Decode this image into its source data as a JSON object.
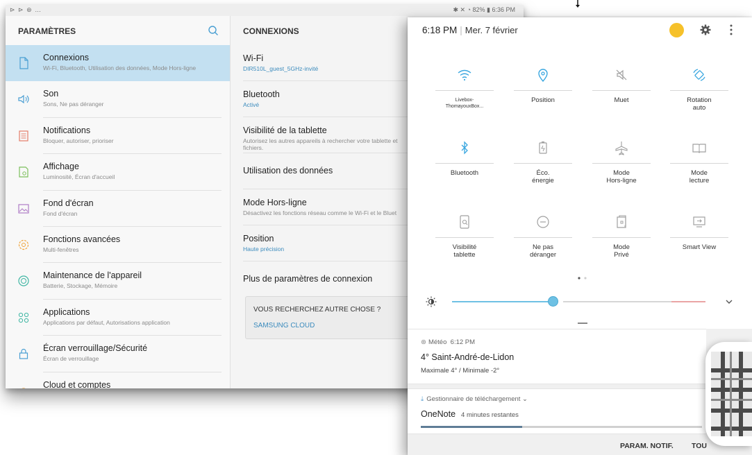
{
  "status_bar": {
    "left_icons": "⊳ ⊳ ⊛ …",
    "right_text": "✱ ✕ ◔ 82% ▮ 6:36 PM"
  },
  "settings": {
    "title": "PARAMÈTRES",
    "items": [
      {
        "label": "Connexions",
        "sub": "Wi-Fi, Bluetooth, Utilisation des données, Mode Hors-ligne",
        "icon": "file-icon",
        "active": true
      },
      {
        "label": "Son",
        "sub": "Sons, Ne pas déranger",
        "icon": "speaker-icon"
      },
      {
        "label": "Notifications",
        "sub": "Bloquer, autoriser, prioriser",
        "icon": "notification-list-icon"
      },
      {
        "label": "Affichage",
        "sub": "Luminosité, Écran d'accueil",
        "icon": "display-icon"
      },
      {
        "label": "Fond d'écran",
        "sub": "Fond d'écran",
        "icon": "image-icon"
      },
      {
        "label": "Fonctions avancées",
        "sub": "Multi-fenêtres",
        "icon": "advanced-gear-icon"
      },
      {
        "label": "Maintenance de l'appareil",
        "sub": "Batterie, Stockage, Mémoire",
        "icon": "maintenance-icon"
      },
      {
        "label": "Applications",
        "sub": "Applications par défaut, Autorisations application",
        "icon": "apps-grid-icon"
      },
      {
        "label": "Écran verrouillage/Sécurité",
        "sub": "Écran de verrouillage",
        "icon": "lock-icon"
      },
      {
        "label": "Cloud et comptes",
        "sub": "",
        "icon": "cloud-key-icon"
      }
    ]
  },
  "connexions": {
    "title": "CONNEXIONS",
    "items": [
      {
        "label": "Wi-Fi",
        "sub": "DIR510L_guest_5GHz-invité",
        "sub_blue": true
      },
      {
        "label": "Bluetooth",
        "sub": "Activé",
        "sub_blue": true
      },
      {
        "label": "Visibilité de la tablette",
        "sub": "Autorisez les autres appareils à rechercher votre tablette et fichiers.",
        "sub_blue": false
      },
      {
        "label": "Utilisation des données",
        "sub": ""
      },
      {
        "label": "Mode Hors-ligne",
        "sub": "Désactivez les fonctions réseau comme le Wi-Fi et le Bluet",
        "sub_blue": false
      },
      {
        "label": "Position",
        "sub": "Haute précision",
        "sub_blue": true
      },
      {
        "label": "Plus de paramètres de connexion",
        "sub": ""
      }
    ],
    "search_card": {
      "question": "VOUS RECHERCHEZ AUTRE CHOSE ?",
      "link": "SAMSUNG CLOUD"
    }
  },
  "quick_panel": {
    "time": "6:18 PM",
    "separator": "|",
    "date": "Mer. 7 février",
    "tiles": [
      {
        "label": "Livebox-\nThomayouxBox...",
        "icon": "wifi-icon",
        "active": true,
        "small": true
      },
      {
        "label": "Position",
        "icon": "location-icon",
        "active": true
      },
      {
        "label": "Muet",
        "icon": "mute-icon",
        "active": false
      },
      {
        "label": "Rotation\nauto",
        "icon": "rotation-icon",
        "active": true
      },
      {
        "label": "Bluetooth",
        "icon": "bluetooth-icon",
        "active": true
      },
      {
        "label": "Éco.\nénergie",
        "icon": "battery-saver-icon",
        "active": false
      },
      {
        "label": "Mode\nHors-ligne",
        "icon": "airplane-icon",
        "active": false
      },
      {
        "label": "Mode\nlecture",
        "icon": "book-icon",
        "active": false
      },
      {
        "label": "Visibilité\ntablette",
        "icon": "tablet-search-icon",
        "active": false
      },
      {
        "label": "Ne pas\ndéranger",
        "icon": "do-not-disturb-icon",
        "active": false
      },
      {
        "label": "Mode\nPrivé",
        "icon": "private-mode-icon",
        "active": false
      },
      {
        "label": "Smart View",
        "icon": "smart-view-icon",
        "active": false
      }
    ],
    "brightness_level": 0.4,
    "notifications": {
      "weather": {
        "app": "Météo",
        "time": "6:12 PM",
        "title": "4° Saint-André-de-Lidon",
        "text": "Maximale 4° / Minimale -2°"
      },
      "download": {
        "app": "Gestionnaire de téléchargement",
        "title": "OneNote",
        "remaining": "4 minutes restantes",
        "progress": 0.36
      }
    },
    "footer": {
      "notif_settings": "PARAM. NOTIF.",
      "clear_all": "TOU"
    }
  },
  "colors": {
    "accent": "#3b8bbd",
    "active_icon": "#3aa7e0",
    "inactive_icon": "#a0a0a0",
    "selected_row": "#c3e0f1"
  }
}
